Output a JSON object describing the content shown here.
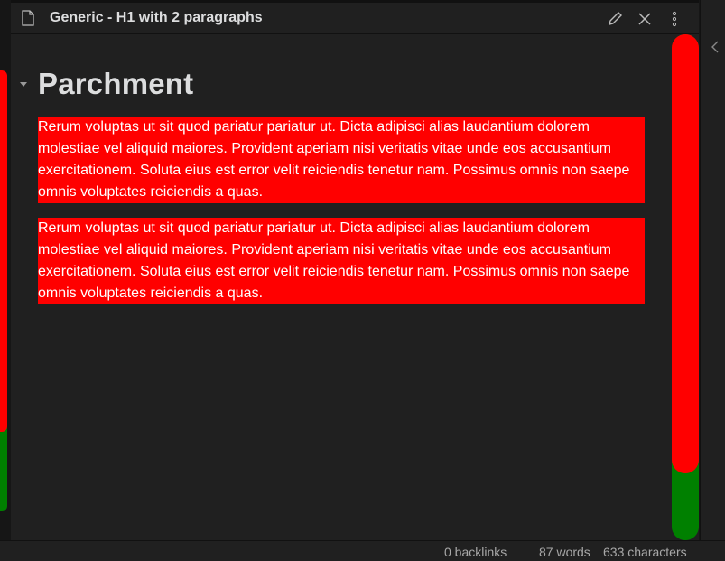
{
  "pane": {
    "title": "Generic - H1 with 2 paragraphs",
    "icons": {
      "file": "file-icon",
      "edit": "pencil-icon",
      "close": "close-icon",
      "more": "more-vertical-icon",
      "sidebar_toggle": "chevron-left-icon"
    }
  },
  "document": {
    "heading": "Parchment",
    "paragraphs": [
      "Rerum voluptas ut sit quod pariatur pariatur ut. Dicta adipisci alias laudantium dolorem molestiae vel aliquid maiores. Provident aperiam nisi veritatis vitae unde eos accusantium exercitationem. Soluta eius est error velit reiciendis tenetur nam. Possimus omnis non saepe omnis voluptates reiciendis a quas.",
      "Rerum voluptas ut sit quod pariatur pariatur ut. Dicta adipisci alias laudantium dolorem molestiae vel aliquid maiores. Provident aperiam nisi veritatis vitae unde eos accusantium exercitationem. Soluta eius est error velit reiciendis tenetur nam. Possimus omnis non saepe omnis voluptates reiciendis a quas."
    ]
  },
  "status": {
    "backlinks": "0 backlinks",
    "words": "87 words",
    "characters": "633 characters"
  },
  "colors": {
    "background": "#202020",
    "highlight": "#ff0000",
    "scroll_green": "#008000",
    "text": "#dcddde"
  }
}
